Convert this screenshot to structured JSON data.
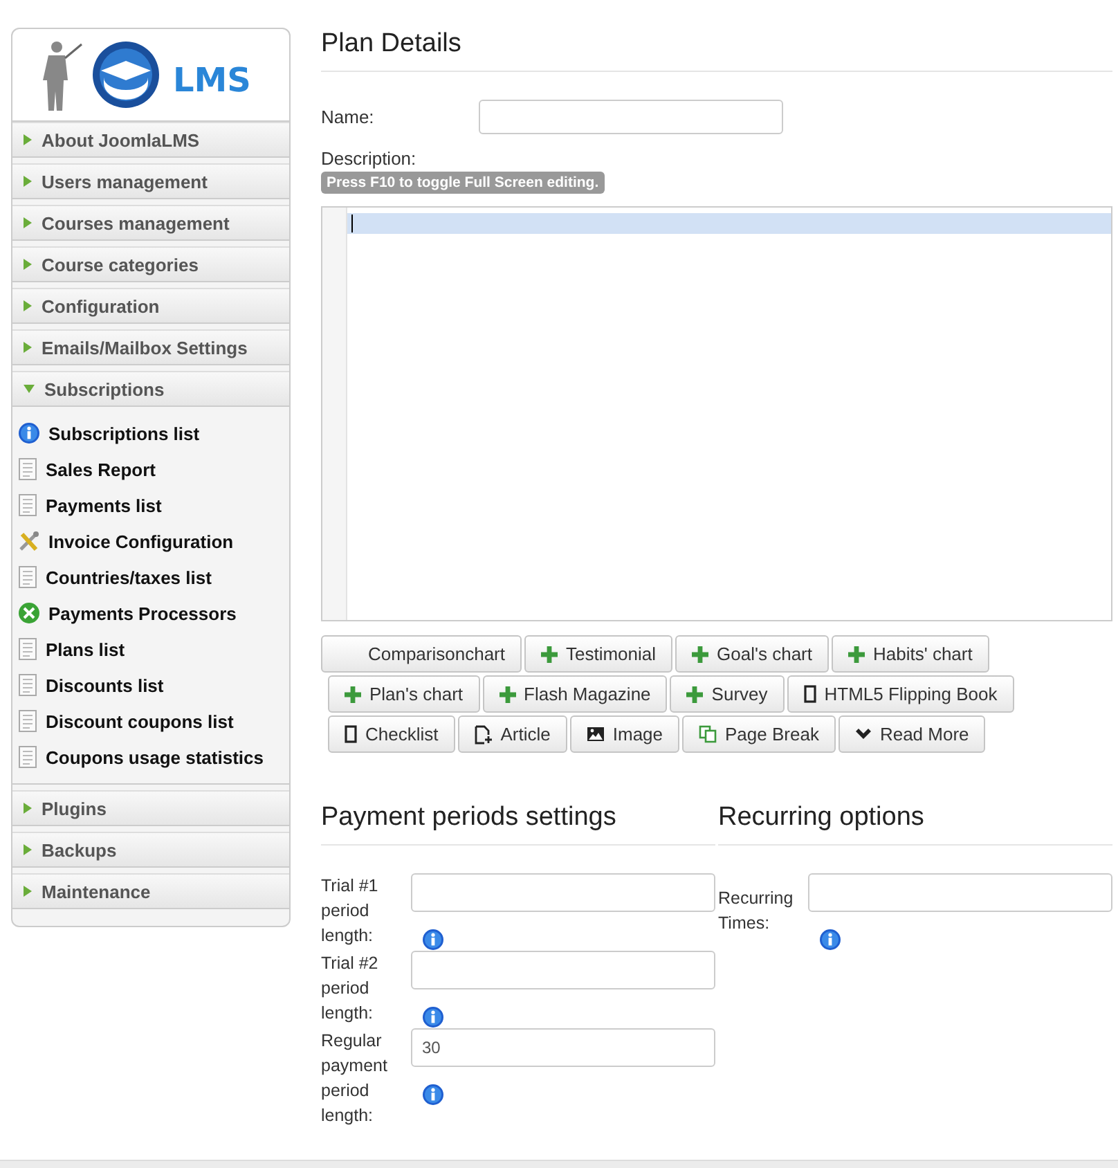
{
  "sidebar": {
    "logo_text": "LMS",
    "sections": [
      {
        "label": "About JoomlaLMS",
        "expanded": false
      },
      {
        "label": "Users management",
        "expanded": false
      },
      {
        "label": "Courses management",
        "expanded": false
      },
      {
        "label": "Course categories",
        "expanded": false
      },
      {
        "label": "Configuration",
        "expanded": false
      },
      {
        "label": "Emails/Mailbox Settings",
        "expanded": false
      },
      {
        "label": "Subscriptions",
        "expanded": true,
        "items": [
          {
            "label": "Subscriptions list",
            "kind": "info"
          },
          {
            "label": "Sales Report",
            "kind": "page"
          },
          {
            "label": "Payments list",
            "kind": "page"
          },
          {
            "label": "Invoice Configuration",
            "kind": "tools"
          },
          {
            "label": "Countries/taxes list",
            "kind": "page"
          },
          {
            "label": "Payments Processors",
            "kind": "processor"
          },
          {
            "label": "Plans list",
            "kind": "page"
          },
          {
            "label": "Discounts list",
            "kind": "page"
          },
          {
            "label": "Discount coupons list",
            "kind": "page"
          },
          {
            "label": "Coupons usage statistics",
            "kind": "page"
          }
        ]
      },
      {
        "label": "Plugins",
        "expanded": false
      },
      {
        "label": "Backups",
        "expanded": false
      },
      {
        "label": "Maintenance",
        "expanded": false
      }
    ]
  },
  "plan_details": {
    "title": "Plan Details",
    "name_label": "Name:",
    "description_label": "Description:",
    "editor_hint": "Press F10 to toggle Full Screen editing.",
    "editor_buttons": [
      [
        {
          "label": "Comparisonchart",
          "kind": "none"
        },
        {
          "label": "Testimonial",
          "kind": "plus"
        },
        {
          "label": "Goal's chart",
          "kind": "plus"
        },
        {
          "label": "Habits' chart",
          "kind": "plus"
        }
      ],
      [
        {
          "label": "Plan's chart",
          "kind": "plus"
        },
        {
          "label": "Flash Magazine",
          "kind": "plus"
        },
        {
          "label": "Survey",
          "kind": "plus"
        },
        {
          "label": "HTML5 Flipping Book",
          "kind": "square"
        }
      ],
      [
        {
          "label": "Checklist",
          "kind": "square"
        },
        {
          "label": "Article",
          "kind": "article"
        },
        {
          "label": "Image",
          "kind": "image"
        },
        {
          "label": "Page Break",
          "kind": "pagebreak"
        },
        {
          "label": "Read More",
          "kind": "chevron"
        }
      ]
    ]
  },
  "payment_periods": {
    "title": "Payment periods settings",
    "fields": [
      {
        "label": "Trial #1 period length:"
      },
      {
        "label": "Trial #2 period length:"
      },
      {
        "label": "Regular payment period length:",
        "value": "30"
      }
    ]
  },
  "recurring_options": {
    "title": "Recurring options",
    "fields": [
      {
        "label": "Recurring Times:"
      }
    ]
  }
}
